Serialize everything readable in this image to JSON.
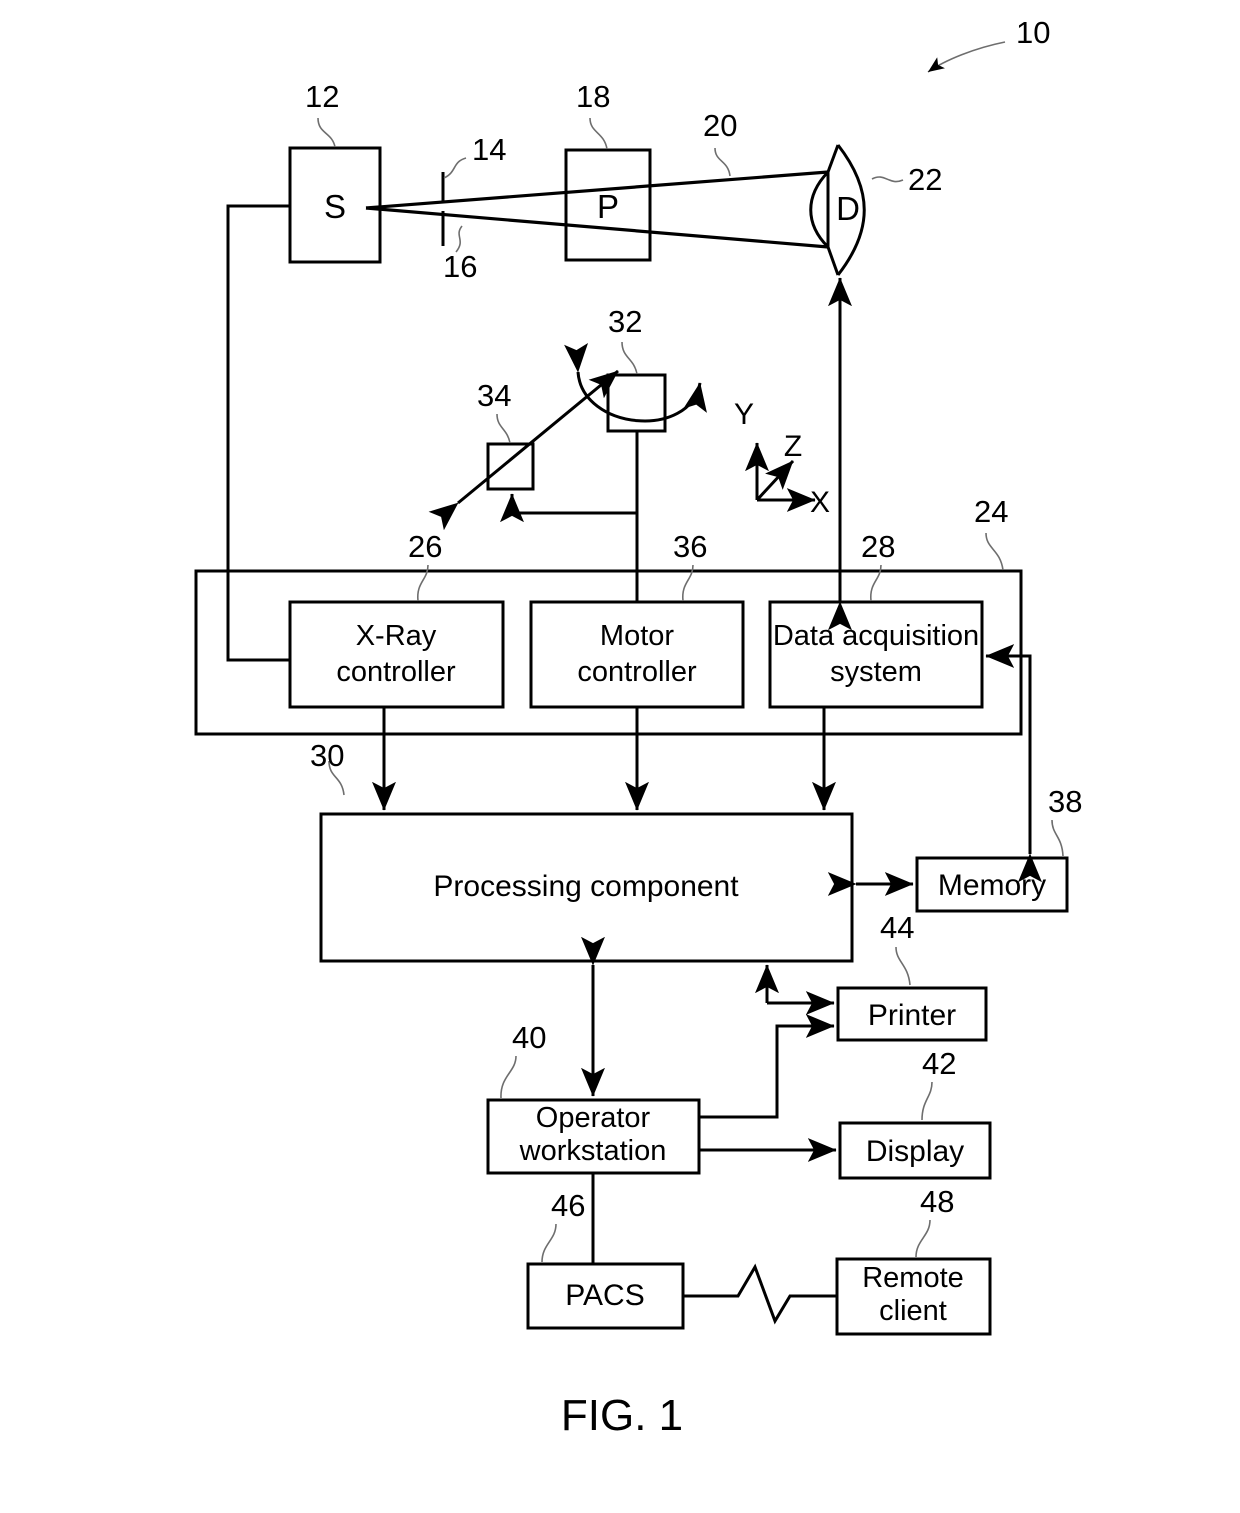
{
  "figure": {
    "caption": "FIG. 1",
    "system_ref": "10"
  },
  "components": {
    "source": {
      "glyph": "S",
      "ref": "12"
    },
    "collimator": {
      "ref_top": "14",
      "ref_bottom": "16"
    },
    "patient": {
      "glyph": "P",
      "ref": "18"
    },
    "beam": {
      "ref": "20"
    },
    "detector": {
      "glyph": "D",
      "ref": "22"
    },
    "system_controller": {
      "ref": "24"
    },
    "xray_controller": {
      "line1": "X-Ray",
      "line2": "controller",
      "ref": "26"
    },
    "motor_controller": {
      "line1": "Motor",
      "line2": "controller",
      "ref": "36"
    },
    "data_acquisition": {
      "line1": "Data acquisition",
      "line2": "system",
      "ref": "28"
    },
    "processing_component": {
      "label": "Processing component",
      "ref": "30"
    },
    "memory": {
      "label": "Memory",
      "ref": "38"
    },
    "printer": {
      "label": "Printer",
      "ref": "44"
    },
    "display": {
      "label": "Display",
      "ref": "42"
    },
    "operator_workstation": {
      "line1": "Operator",
      "line2": "workstation",
      "ref": "40"
    },
    "pacs": {
      "label": "PACS",
      "ref": "46"
    },
    "remote_client": {
      "line1": "Remote",
      "line2": "client",
      "ref": "48"
    },
    "gantry_motor": {
      "ref": "32"
    },
    "table_motor": {
      "ref": "34"
    }
  },
  "axes": {
    "y": "Y",
    "z": "Z",
    "x": "X"
  }
}
